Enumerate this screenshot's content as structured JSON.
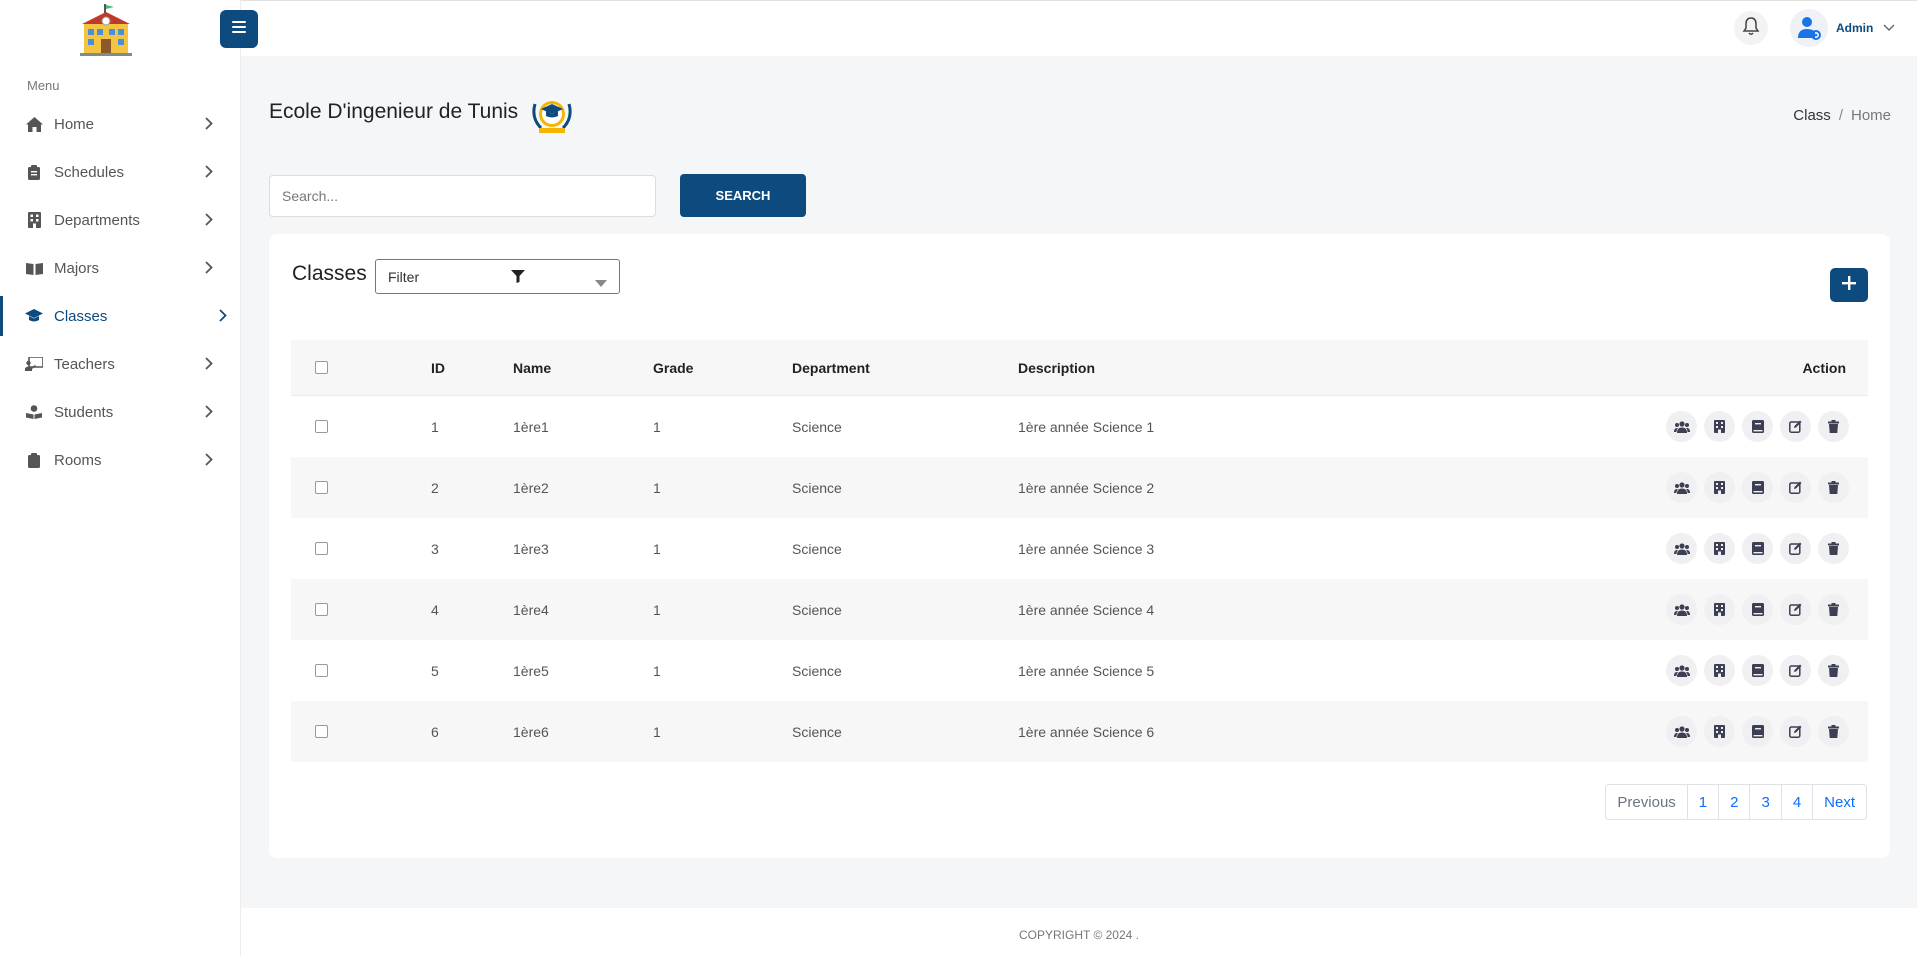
{
  "sidebar": {
    "menu_title": "Menu",
    "items": [
      {
        "label": "Home",
        "icon": "home-icon"
      },
      {
        "label": "Schedules",
        "icon": "clipboard-icon"
      },
      {
        "label": "Departments",
        "icon": "building-icon"
      },
      {
        "label": "Majors",
        "icon": "book-open-icon"
      },
      {
        "label": "Classes",
        "icon": "graduation-cap-icon",
        "active": true
      },
      {
        "label": "Teachers",
        "icon": "chalkboard-teacher-icon"
      },
      {
        "label": "Students",
        "icon": "user-book-icon"
      },
      {
        "label": "Rooms",
        "icon": "clipboard-icon"
      }
    ]
  },
  "topbar": {
    "user_name": "Admin"
  },
  "header": {
    "title": "Ecole D'ingenieur de Tunis",
    "breadcrumb": [
      "Class",
      "Home"
    ]
  },
  "search": {
    "placeholder": "Search...",
    "value": "",
    "button_label": "SEARCH"
  },
  "classes": {
    "title": "Classes",
    "filter_label": "Filter",
    "columns": {
      "id": "ID",
      "name": "Name",
      "grade": "Grade",
      "department": "Department",
      "description": "Description",
      "action": "Action"
    },
    "rows": [
      {
        "id": "1",
        "name": "1ère1",
        "grade": "1",
        "department": "Science",
        "description": "1ère année Science 1"
      },
      {
        "id": "2",
        "name": "1ère2",
        "grade": "1",
        "department": "Science",
        "description": "1ère année Science 2"
      },
      {
        "id": "3",
        "name": "1ère3",
        "grade": "1",
        "department": "Science",
        "description": "1ère année Science 3"
      },
      {
        "id": "4",
        "name": "1ère4",
        "grade": "1",
        "department": "Science",
        "description": "1ère année Science 4"
      },
      {
        "id": "5",
        "name": "1ère5",
        "grade": "1",
        "department": "Science",
        "description": "1ère année Science 5"
      },
      {
        "id": "6",
        "name": "1ère6",
        "grade": "1",
        "department": "Science",
        "description": "1ère année Science 6"
      }
    ],
    "row_actions": [
      "students-icon",
      "building-icon",
      "book-icon",
      "edit-icon",
      "trash-icon"
    ]
  },
  "pagination": {
    "previous": "Previous",
    "pages": [
      "1",
      "2",
      "3",
      "4"
    ],
    "next": "Next"
  },
  "footer": {
    "copyright": "COPYRIGHT © 2024 ."
  },
  "colors": {
    "primary": "#0d4a7e",
    "link": "#0d6efd",
    "background": "#f5f6f8"
  }
}
